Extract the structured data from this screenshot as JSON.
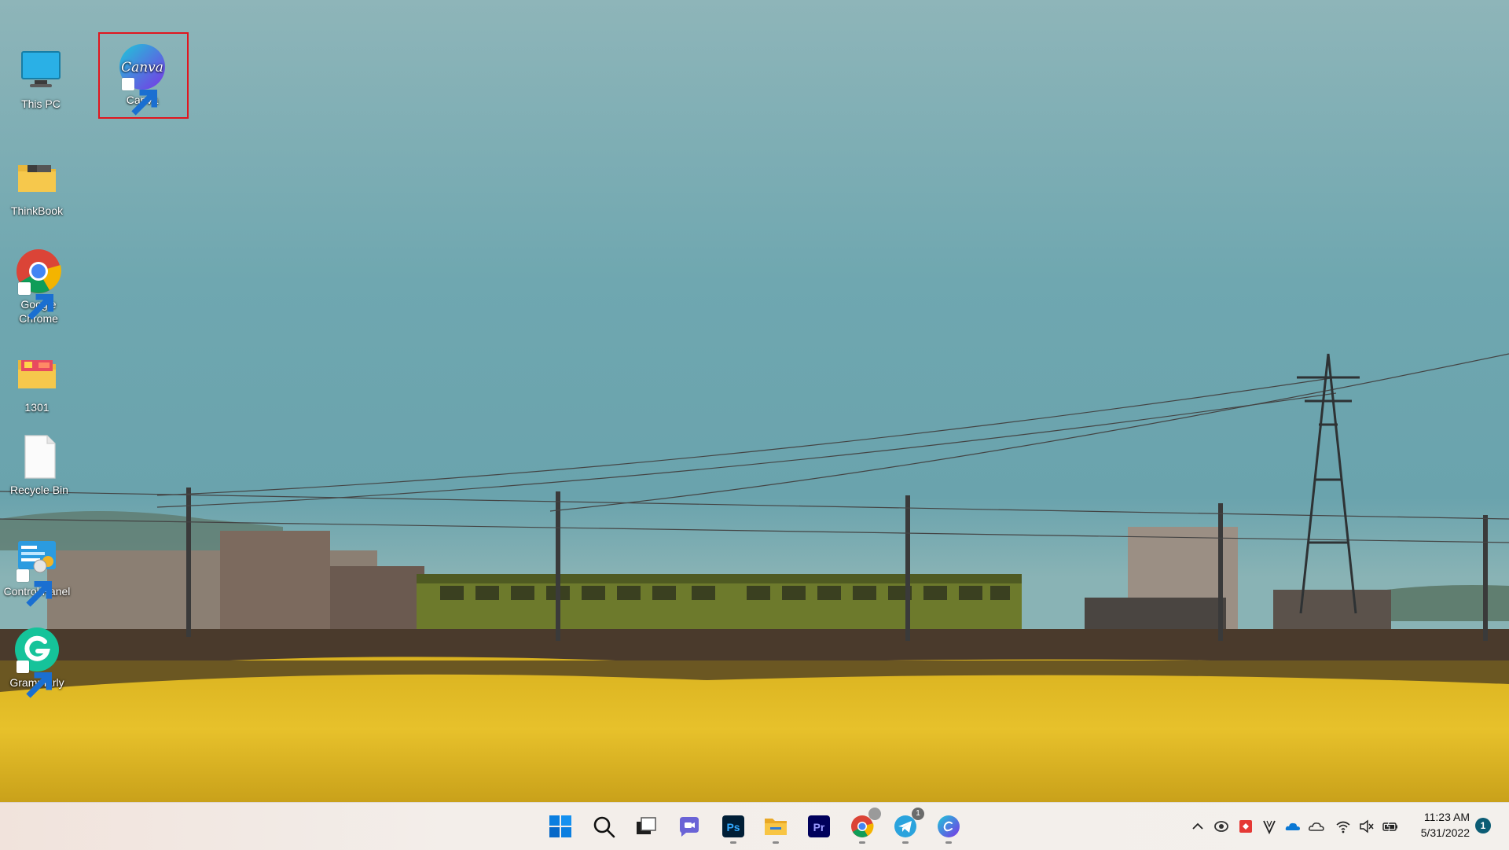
{
  "desktop": {
    "icons": [
      {
        "id": "this-pc",
        "label": "This PC",
        "icon": "monitor-icon",
        "shortcut": false
      },
      {
        "id": "canva",
        "label": "Canva",
        "icon": "canva-icon",
        "shortcut": true,
        "glyph_text": "Canva",
        "selected": true
      },
      {
        "id": "thinkbook",
        "label": "ThinkBook",
        "icon": "folder-icon",
        "shortcut": false
      },
      {
        "id": "google-chrome",
        "label": "Google Chrome",
        "icon": "chrome-icon",
        "shortcut": true
      },
      {
        "id": "1301",
        "label": "1301",
        "icon": "folder-icon",
        "shortcut": false
      },
      {
        "id": "recycle-bin",
        "label": "Recycle Bin",
        "icon": "recycle-bin-icon",
        "shortcut": false
      },
      {
        "id": "control-panel",
        "label": "Control Panel",
        "icon": "control-panel-icon",
        "shortcut": true
      },
      {
        "id": "grammarly",
        "label": "Grammarly",
        "icon": "grammarly-icon",
        "shortcut": true
      }
    ],
    "highlight_color": "#e0161e"
  },
  "taskbar": {
    "apps": [
      {
        "id": "start",
        "icon": "windows-start-icon"
      },
      {
        "id": "search",
        "icon": "search-icon"
      },
      {
        "id": "task-view",
        "icon": "task-view-icon"
      },
      {
        "id": "chat",
        "icon": "teams-chat-icon"
      },
      {
        "id": "photoshop",
        "icon": "photoshop-icon",
        "glyph_text": "Ps",
        "running": true
      },
      {
        "id": "file-explorer",
        "icon": "file-explorer-icon",
        "running": true
      },
      {
        "id": "premiere",
        "icon": "premiere-pro-icon",
        "glyph_text": "Pr"
      },
      {
        "id": "chrome",
        "icon": "chrome-icon",
        "running": true
      },
      {
        "id": "telegram",
        "icon": "telegram-icon",
        "badge": "1",
        "running": true
      },
      {
        "id": "canva",
        "icon": "canva-icon",
        "running": true
      }
    ],
    "tray": [
      {
        "id": "overflow",
        "icon": "chevron-up-icon"
      },
      {
        "id": "app1",
        "icon": "tray-app-icon"
      },
      {
        "id": "app2",
        "icon": "tray-red-app-icon"
      },
      {
        "id": "vpn",
        "icon": "v-icon"
      },
      {
        "id": "onedrive-blue",
        "icon": "onedrive-icon"
      },
      {
        "id": "onedrive-gray",
        "icon": "cloud-icon"
      },
      {
        "id": "wifi",
        "icon": "wifi-icon"
      },
      {
        "id": "volume",
        "icon": "volume-muted-icon"
      },
      {
        "id": "battery",
        "icon": "battery-icon"
      }
    ],
    "clock": {
      "time": "11:23 AM",
      "date": "5/31/2022"
    },
    "notifications": "1"
  }
}
